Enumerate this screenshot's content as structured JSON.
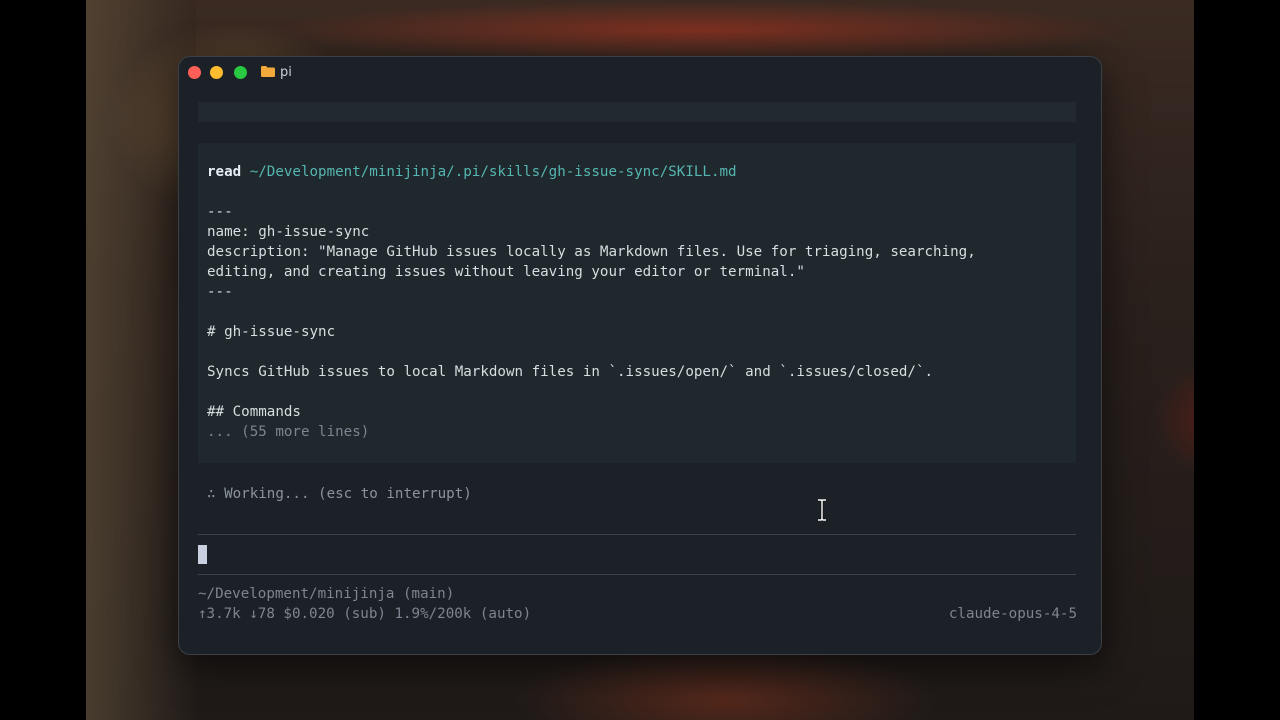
{
  "window": {
    "title": "pi",
    "folder_icon": "folder-icon",
    "controls": [
      "close",
      "minimize",
      "zoom"
    ]
  },
  "tool_call": {
    "command": "read",
    "path": "~/Development/minijinja/.pi/skills/gh-issue-sync/SKILL.md",
    "lines": [
      "---",
      "name: gh-issue-sync",
      "description: \"Manage GitHub issues locally as Markdown files. Use for triaging, searching,",
      "editing, and creating issues without leaving your editor or terminal.\"",
      "---",
      "",
      "# gh-issue-sync",
      "",
      "Syncs GitHub issues to local Markdown files in `.issues/open/` and `.issues/closed/`.",
      "",
      "## Commands"
    ],
    "truncated": "... (55 more lines)"
  },
  "status": "∴ Working... (esc to interrupt)",
  "input": {
    "value": ""
  },
  "footer": {
    "cwd": "~/Development/minijinja (main)",
    "stats": "↑3.7k ↓78 $0.020 (sub) 1.9%/200k (auto)",
    "model": "claude-opus-4-5"
  },
  "colors": {
    "background": "#1b2126",
    "tool_block": "#1f282c",
    "path": "#56b6b2",
    "muted": "#7d8590"
  }
}
